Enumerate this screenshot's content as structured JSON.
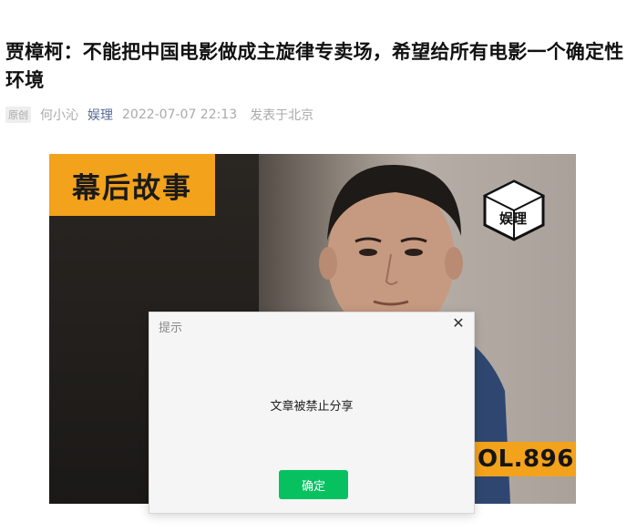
{
  "article": {
    "title": "贾樟柯：不能把中国电影做成主旋律专卖场，希望给所有电影一个确定性环境",
    "badge": "原创",
    "author": "何小沁",
    "account": "娱理",
    "date": "2022-07-07 22:13",
    "location": "发表于北京"
  },
  "hero": {
    "tag": "幕后故事",
    "logo_text": "娱理",
    "vol": "OL.896"
  },
  "dialog": {
    "title": "提示",
    "message": "文章被禁止分享",
    "ok_label": "确定",
    "close_symbol": "✕"
  },
  "colors": {
    "accent_orange": "#f3a21b",
    "confirm_green": "#07c160",
    "account_link": "#576b95"
  }
}
